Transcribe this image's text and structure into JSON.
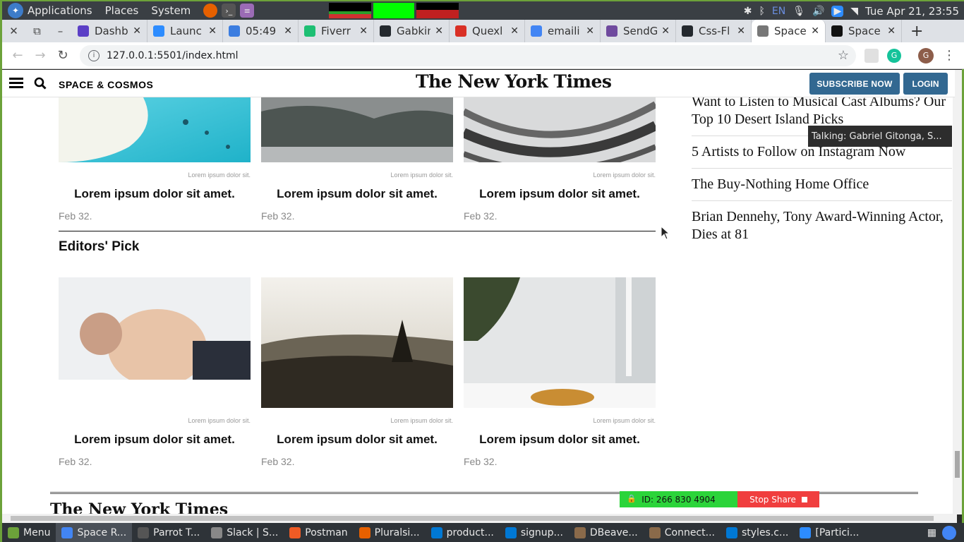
{
  "os_panel": {
    "applications": "Applications",
    "places": "Places",
    "system": "System",
    "datetime": "Tue Apr 21, 23:55",
    "lang": "EN"
  },
  "tabs": [
    {
      "label": "Dashb",
      "icon": "dashboard-icon",
      "color": "#5b3fc6"
    },
    {
      "label": "Launc",
      "icon": "zoom-icon",
      "color": "#2d8cff"
    },
    {
      "label": "05:49",
      "icon": "timer-icon",
      "color": "#3b7de0"
    },
    {
      "label": "Fiverr",
      "icon": "fiverr-icon",
      "color": "#1dbf73"
    },
    {
      "label": "Gabkin",
      "icon": "github-icon",
      "color": "#24292e"
    },
    {
      "label": "Quexl",
      "icon": "gmail-icon",
      "color": "#d93025"
    },
    {
      "label": "emaili",
      "icon": "google-icon",
      "color": "#4285f4"
    },
    {
      "label": "SendG",
      "icon": "heroku-icon",
      "color": "#6f4a9e"
    },
    {
      "label": "Css-Fl",
      "icon": "github-icon",
      "color": "#24292e"
    },
    {
      "label": "Space",
      "icon": "globe-icon",
      "color": "#777777",
      "active": true
    },
    {
      "label": "Space",
      "icon": "nyt-icon",
      "color": "#111111"
    }
  ],
  "address": {
    "url": "127.0.0.1:5501/index.html"
  },
  "header": {
    "section": "SPACE & COSMOS",
    "logo": "The New York Times",
    "subscribe": "SUBSCRIBE NOW",
    "login": "LOGIN"
  },
  "top_cards": [
    {
      "caption": "Lorem ipsum dolor sit.",
      "headline": "Lorem ipsum dolor sit amet.",
      "date": "Feb 32."
    },
    {
      "caption": "Lorem ipsum dolor sit.",
      "headline": "Lorem ipsum dolor sit amet.",
      "date": "Feb 32."
    },
    {
      "caption": "Lorem ipsum dolor sit.",
      "headline": "Lorem ipsum dolor sit amet.",
      "date": "Feb 32."
    }
  ],
  "editors_pick": {
    "title": "Editors' Pick",
    "cards": [
      {
        "caption": "Lorem ipsum dolor sit.",
        "headline": "Lorem ipsum dolor sit amet.",
        "date": "Feb 32."
      },
      {
        "caption": "Lorem ipsum dolor sit.",
        "headline": "Lorem ipsum dolor sit amet.",
        "date": "Feb 32."
      },
      {
        "caption": "Lorem ipsum dolor sit.",
        "headline": "Lorem ipsum dolor sit amet.",
        "date": "Feb 32."
      }
    ]
  },
  "sidebar": [
    "Want to Listen to Musical Cast Albums? Our Top 10 Desert Island Picks",
    "5 Artists to Follow on Instagram Now",
    "The Buy-Nothing Home Office",
    "Brian Dennehy, Tony Award-Winning Actor, Dies at 81"
  ],
  "tooltip": "Talking: Gabriel Gitonga, S...",
  "footer_logo": "The New York Times",
  "zoom_share": {
    "id": "ID: 266 830 4904",
    "stop": "Stop Share"
  },
  "taskbar": [
    {
      "label": "Menu",
      "icon": "mint-menu-icon",
      "color": "#6ca23a"
    },
    {
      "label": "Space R...",
      "icon": "chrome-icon",
      "color": "#4285f4",
      "active": true
    },
    {
      "label": "Parrot T...",
      "icon": "terminal-icon",
      "color": "#555555"
    },
    {
      "label": "Slack | S...",
      "icon": "window-icon",
      "color": "#888888"
    },
    {
      "label": "Postman",
      "icon": "postman-icon",
      "color": "#ef5b25"
    },
    {
      "label": "Pluralsi...",
      "icon": "firefox-icon",
      "color": "#e66000"
    },
    {
      "label": "product...",
      "icon": "vscode-icon",
      "color": "#0078d4"
    },
    {
      "label": "signup...",
      "icon": "vscode-icon",
      "color": "#0078d4"
    },
    {
      "label": "DBeave...",
      "icon": "dbeaver-icon",
      "color": "#8a6a4a"
    },
    {
      "label": "Connect...",
      "icon": "dbeaver-icon",
      "color": "#8a6a4a"
    },
    {
      "label": "styles.c...",
      "icon": "vscode-icon",
      "color": "#0078d4"
    },
    {
      "label": "[Partici...",
      "icon": "zoom-icon",
      "color": "#2d8cff"
    }
  ]
}
